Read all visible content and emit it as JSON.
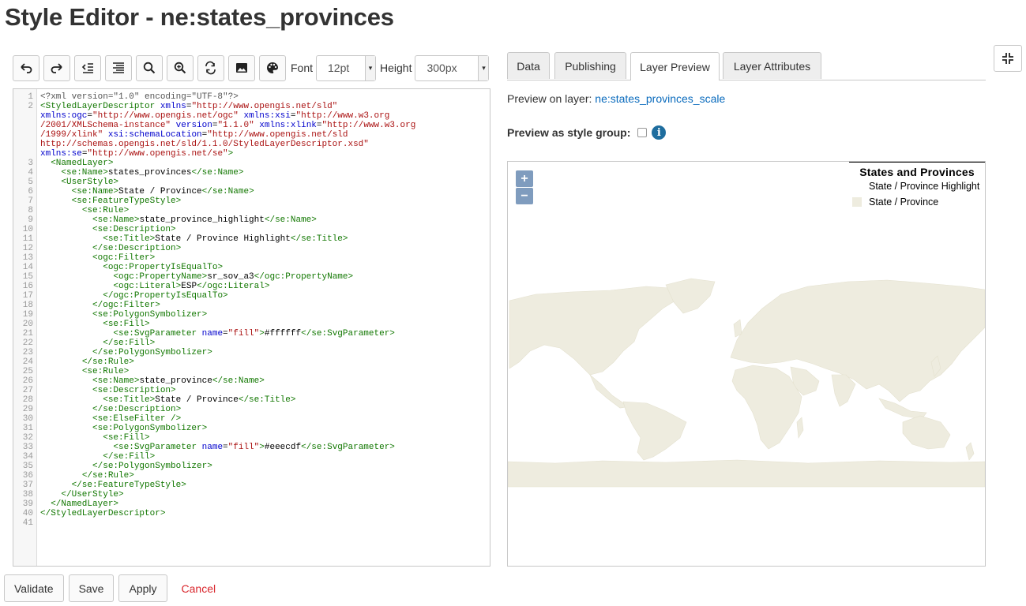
{
  "page_title": "Style Editor - ne:states_provinces",
  "toolbar": {
    "font_label": "Font",
    "font_value": "12pt",
    "height_label": "Height",
    "height_value": "300px"
  },
  "tabs": [
    {
      "label": "Data"
    },
    {
      "label": "Publishing"
    },
    {
      "label": "Layer Preview",
      "active": true
    },
    {
      "label": "Layer Attributes"
    }
  ],
  "preview": {
    "on_layer_label": "Preview on layer:",
    "layer_name": "ne:states_provinces_scale",
    "style_group_label": "Preview as style group:",
    "info_icon": "i"
  },
  "map": {
    "zoom_in": "+",
    "zoom_out": "−",
    "land_color": "#eeecdf",
    "legend": {
      "title": "States and Provinces",
      "items": [
        {
          "label": "State / Province Highlight",
          "color": "#ffffff"
        },
        {
          "label": "State / Province",
          "color": "#eeecdf"
        }
      ]
    }
  },
  "buttons": {
    "validate": "Validate",
    "save": "Save",
    "apply": "Apply",
    "cancel": "Cancel"
  },
  "code_lines": [
    [
      [
        "pi",
        "<?xml version=\"1.0\" encoding=\"UTF-8\"?>"
      ]
    ],
    [
      [
        "tg",
        "<StyledLayerDescriptor "
      ],
      [
        "at",
        "xmlns"
      ],
      [
        "tx",
        "="
      ],
      [
        "st",
        "\"http://www.opengis.net/sld\""
      ]
    ],
    [
      [
        "at",
        "xmlns:ogc"
      ],
      [
        "tx",
        "="
      ],
      [
        "st",
        "\"http://www.opengis.net/ogc\" "
      ],
      [
        "at",
        "xmlns:xsi"
      ],
      [
        "tx",
        "="
      ],
      [
        "st",
        "\"http://www.w3.org"
      ]
    ],
    [
      [
        "st",
        "/2001/XMLSchema-instance\" "
      ],
      [
        "at",
        "version"
      ],
      [
        "tx",
        "="
      ],
      [
        "st",
        "\"1.1.0\" "
      ],
      [
        "at",
        "xmlns:xlink"
      ],
      [
        "tx",
        "="
      ],
      [
        "st",
        "\"http://www.w3.org"
      ]
    ],
    [
      [
        "st",
        "/1999/xlink\" "
      ],
      [
        "at",
        "xsi:schemaLocation"
      ],
      [
        "tx",
        "="
      ],
      [
        "st",
        "\"http://www.opengis.net/sld"
      ]
    ],
    [
      [
        "st",
        "http://schemas.opengis.net/sld/1.1.0/StyledLayerDescriptor.xsd\""
      ]
    ],
    [
      [
        "at",
        "xmlns:se"
      ],
      [
        "tx",
        "="
      ],
      [
        "st",
        "\"http://www.opengis.net/se\""
      ],
      [
        "tg",
        ">"
      ]
    ],
    [
      [
        "tx",
        "  "
      ],
      [
        "tg",
        "<NamedLayer>"
      ]
    ],
    [
      [
        "tx",
        "    "
      ],
      [
        "tg",
        "<se:Name>"
      ],
      [
        "tx",
        "states_provinces"
      ],
      [
        "tg",
        "</se:Name>"
      ]
    ],
    [
      [
        "tx",
        "    "
      ],
      [
        "tg",
        "<UserStyle>"
      ]
    ],
    [
      [
        "tx",
        "      "
      ],
      [
        "tg",
        "<se:Name>"
      ],
      [
        "tx",
        "State / Province"
      ],
      [
        "tg",
        "</se:Name>"
      ]
    ],
    [
      [
        "tx",
        "      "
      ],
      [
        "tg",
        "<se:FeatureTypeStyle>"
      ]
    ],
    [
      [
        "tx",
        "        "
      ],
      [
        "tg",
        "<se:Rule>"
      ]
    ],
    [
      [
        "tx",
        "          "
      ],
      [
        "tg",
        "<se:Name>"
      ],
      [
        "tx",
        "state_province_highlight"
      ],
      [
        "tg",
        "</se:Name>"
      ]
    ],
    [
      [
        "tx",
        "          "
      ],
      [
        "tg",
        "<se:Description>"
      ]
    ],
    [
      [
        "tx",
        "            "
      ],
      [
        "tg",
        "<se:Title>"
      ],
      [
        "tx",
        "State / Province Highlight"
      ],
      [
        "tg",
        "</se:Title>"
      ]
    ],
    [
      [
        "tx",
        "          "
      ],
      [
        "tg",
        "</se:Description>"
      ]
    ],
    [
      [
        "tx",
        "          "
      ],
      [
        "tg",
        "<ogc:Filter>"
      ]
    ],
    [
      [
        "tx",
        "            "
      ],
      [
        "tg",
        "<ogc:PropertyIsEqualTo>"
      ]
    ],
    [
      [
        "tx",
        "              "
      ],
      [
        "tg",
        "<ogc:PropertyName>"
      ],
      [
        "tx",
        "sr_sov_a3"
      ],
      [
        "tg",
        "</ogc:PropertyName>"
      ]
    ],
    [
      [
        "tx",
        "              "
      ],
      [
        "tg",
        "<ogc:Literal>"
      ],
      [
        "tx",
        "ESP"
      ],
      [
        "tg",
        "</ogc:Literal>"
      ]
    ],
    [
      [
        "tx",
        "            "
      ],
      [
        "tg",
        "</ogc:PropertyIsEqualTo>"
      ]
    ],
    [
      [
        "tx",
        "          "
      ],
      [
        "tg",
        "</ogc:Filter>"
      ]
    ],
    [
      [
        "tx",
        "          "
      ],
      [
        "tg",
        "<se:PolygonSymbolizer>"
      ]
    ],
    [
      [
        "tx",
        "            "
      ],
      [
        "tg",
        "<se:Fill>"
      ]
    ],
    [
      [
        "tx",
        "              "
      ],
      [
        "tg",
        "<se:SvgParameter "
      ],
      [
        "at",
        "name"
      ],
      [
        "tx",
        "="
      ],
      [
        "st",
        "\"fill\""
      ],
      [
        "tg",
        ">"
      ],
      [
        "tx",
        "#ffffff"
      ],
      [
        "tg",
        "</se:SvgParameter>"
      ]
    ],
    [
      [
        "tx",
        "            "
      ],
      [
        "tg",
        "</se:Fill>"
      ]
    ],
    [
      [
        "tx",
        "          "
      ],
      [
        "tg",
        "</se:PolygonSymbolizer>"
      ]
    ],
    [
      [
        "tx",
        "        "
      ],
      [
        "tg",
        "</se:Rule>"
      ]
    ],
    [
      [
        "tx",
        "        "
      ],
      [
        "tg",
        "<se:Rule>"
      ]
    ],
    [
      [
        "tx",
        "          "
      ],
      [
        "tg",
        "<se:Name>"
      ],
      [
        "tx",
        "state_province"
      ],
      [
        "tg",
        "</se:Name>"
      ]
    ],
    [
      [
        "tx",
        "          "
      ],
      [
        "tg",
        "<se:Description>"
      ]
    ],
    [
      [
        "tx",
        "            "
      ],
      [
        "tg",
        "<se:Title>"
      ],
      [
        "tx",
        "State / Province"
      ],
      [
        "tg",
        "</se:Title>"
      ]
    ],
    [
      [
        "tx",
        "          "
      ],
      [
        "tg",
        "</se:Description>"
      ]
    ],
    [
      [
        "tx",
        "          "
      ],
      [
        "tg",
        "<se:ElseFilter />"
      ]
    ],
    [
      [
        "tx",
        "          "
      ],
      [
        "tg",
        "<se:PolygonSymbolizer>"
      ]
    ],
    [
      [
        "tx",
        "            "
      ],
      [
        "tg",
        "<se:Fill>"
      ]
    ],
    [
      [
        "tx",
        "              "
      ],
      [
        "tg",
        "<se:SvgParameter "
      ],
      [
        "at",
        "name"
      ],
      [
        "tx",
        "="
      ],
      [
        "st",
        "\"fill\""
      ],
      [
        "tg",
        ">"
      ],
      [
        "tx",
        "#eeecdf"
      ],
      [
        "tg",
        "</se:SvgParameter>"
      ]
    ],
    [
      [
        "tx",
        "            "
      ],
      [
        "tg",
        "</se:Fill>"
      ]
    ],
    [
      [
        "tx",
        "          "
      ],
      [
        "tg",
        "</se:PolygonSymbolizer>"
      ]
    ],
    [
      [
        "tx",
        "        "
      ],
      [
        "tg",
        "</se:Rule>"
      ]
    ],
    [
      [
        "tx",
        "      "
      ],
      [
        "tg",
        "</se:FeatureTypeStyle>"
      ]
    ],
    [
      [
        "tx",
        "    "
      ],
      [
        "tg",
        "</UserStyle>"
      ]
    ],
    [
      [
        "tx",
        "  "
      ],
      [
        "tg",
        "</NamedLayer>"
      ]
    ],
    [
      [
        "tg",
        "</StyledLayerDescriptor>"
      ]
    ],
    []
  ],
  "line_numbers": [
    {
      "n": "1",
      "row": 0
    },
    {
      "n": "2",
      "row": 1
    },
    {
      "n": "3",
      "row": 7
    },
    {
      "n": "4",
      "row": 8
    },
    {
      "n": "5",
      "row": 9
    },
    {
      "n": "6",
      "row": 10
    },
    {
      "n": "7",
      "row": 11
    },
    {
      "n": "8",
      "row": 12
    },
    {
      "n": "9",
      "row": 13
    },
    {
      "n": "10",
      "row": 14
    },
    {
      "n": "11",
      "row": 15
    },
    {
      "n": "12",
      "row": 16
    },
    {
      "n": "13",
      "row": 17
    },
    {
      "n": "14",
      "row": 18
    },
    {
      "n": "15",
      "row": 19
    },
    {
      "n": "16",
      "row": 20
    },
    {
      "n": "17",
      "row": 21
    },
    {
      "n": "18",
      "row": 22
    },
    {
      "n": "19",
      "row": 23
    },
    {
      "n": "20",
      "row": 24
    },
    {
      "n": "21",
      "row": 25
    },
    {
      "n": "22",
      "row": 26
    },
    {
      "n": "23",
      "row": 27
    },
    {
      "n": "24",
      "row": 28
    },
    {
      "n": "25",
      "row": 29
    },
    {
      "n": "26",
      "row": 30
    },
    {
      "n": "27",
      "row": 31
    },
    {
      "n": "28",
      "row": 32
    },
    {
      "n": "29",
      "row": 33
    },
    {
      "n": "30",
      "row": 34
    },
    {
      "n": "31",
      "row": 35
    },
    {
      "n": "32",
      "row": 36
    },
    {
      "n": "33",
      "row": 37
    },
    {
      "n": "34",
      "row": 38
    },
    {
      "n": "35",
      "row": 39
    },
    {
      "n": "36",
      "row": 40
    },
    {
      "n": "37",
      "row": 41
    },
    {
      "n": "38",
      "row": 42
    },
    {
      "n": "39",
      "row": 43
    },
    {
      "n": "40",
      "row": 44
    },
    {
      "n": "41",
      "row": 45
    }
  ]
}
